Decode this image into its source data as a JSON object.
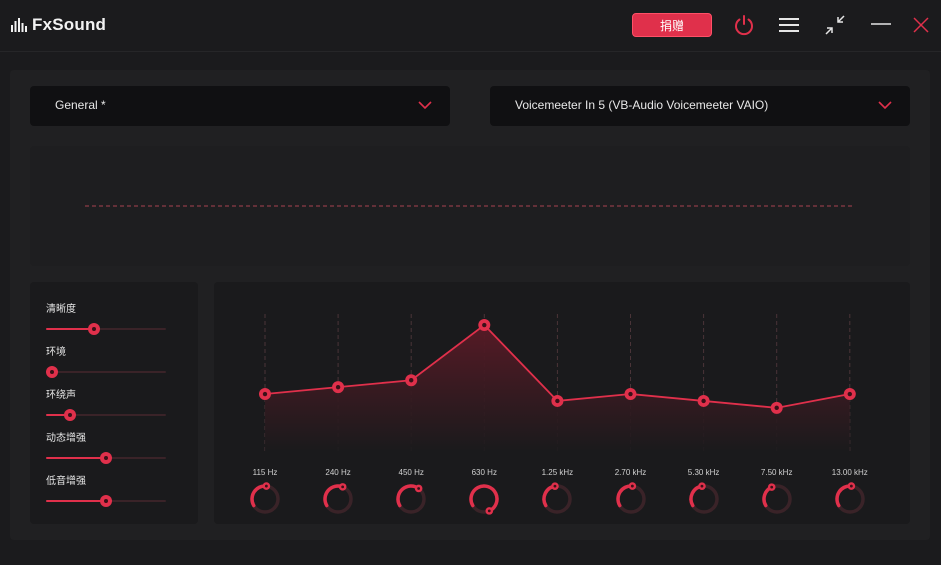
{
  "app": {
    "logo_text": "FxSound",
    "donate_label": "捐赠",
    "icons": [
      "power-icon",
      "menu-icon",
      "minimize-to-mini-icon",
      "minimize-icon",
      "close-icon"
    ],
    "accent_color": "#e0304b"
  },
  "preset": {
    "selected": "General *"
  },
  "output_device": {
    "selected": "Voicemeeter In 5 (VB-Audio Voicemeeter VAIO)"
  },
  "effects": [
    {
      "label": "清晰度",
      "value": 0.4
    },
    {
      "label": "环境",
      "value": 0.0
    },
    {
      "label": "环绕声",
      "value": 0.2
    },
    {
      "label": "动态增强",
      "value": 0.5
    },
    {
      "label": "低音增强",
      "value": 0.5
    }
  ],
  "eq": {
    "bands": [
      {
        "label": "115 Hz",
        "gain": 0.42
      },
      {
        "label": "240 Hz",
        "gain": 0.47
      },
      {
        "label": "450 Hz",
        "gain": 0.52
      },
      {
        "label": "630 Hz",
        "gain": 0.92
      },
      {
        "label": "1.25 kHz",
        "gain": 0.37
      },
      {
        "label": "2.70 kHz",
        "gain": 0.42
      },
      {
        "label": "5.30 kHz",
        "gain": 0.37
      },
      {
        "label": "7.50 kHz",
        "gain": 0.32
      },
      {
        "label": "13.00 kHz",
        "gain": 0.42
      }
    ]
  }
}
